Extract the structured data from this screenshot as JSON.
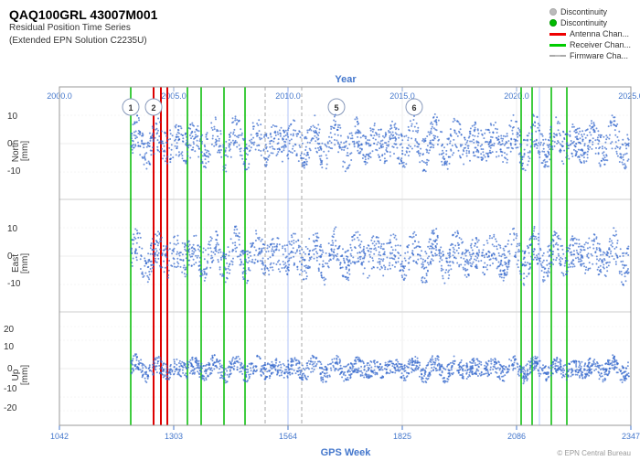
{
  "title": "QAQ100GRL 43007M001",
  "subtitle_line1": "Residual Position Time Series",
  "subtitle_line2": "(Extended EPN Solution C2235U)",
  "legend": {
    "discontinuity_dot_label": "Discontinuity",
    "antenna_chan_label": "Antenna Chan...",
    "receiver_chan_label": "Receiver Chan...",
    "firmware_chan_label": "Firmware Cha...",
    "discontinuity_gray_label": "Discontinuity"
  },
  "x_axis_top_label": "Year",
  "x_axis_bottom_label": "GPS Week",
  "year_ticks": [
    "2000.0",
    "2005.0",
    "2010.0",
    "2015.0",
    "2020.0",
    "2025.0"
  ],
  "gps_ticks": [
    "1042",
    "1303",
    "1564",
    "1825",
    "2086",
    "2347"
  ],
  "y_panels": [
    {
      "label": "North\n[mm]",
      "y_min": -10,
      "y_max": 10
    },
    {
      "label": "East\n[mm]",
      "y_min": -10,
      "y_max": 10
    },
    {
      "label": "Up\n[mm]",
      "y_min": -20,
      "y_max": 20
    }
  ],
  "discontinuity_markers": [
    1,
    2,
    5,
    6
  ],
  "watermark": "© EPN Central Bureau"
}
